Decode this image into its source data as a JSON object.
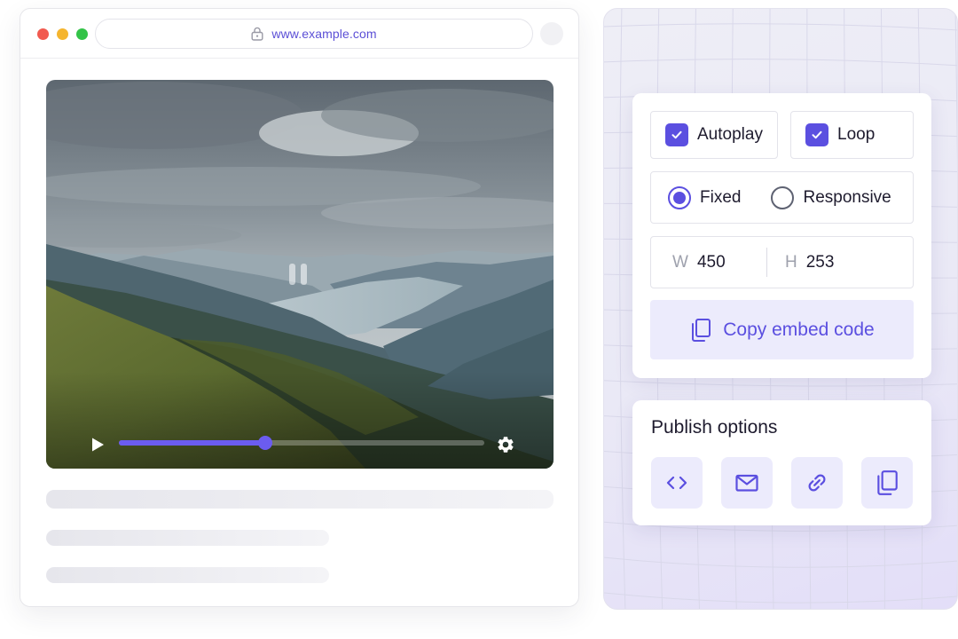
{
  "browser": {
    "url": "www.example.com",
    "icons": {
      "lock": "lock-icon"
    }
  },
  "player": {
    "progress_fraction": 0.4,
    "state": "paused",
    "icons": {
      "play": "play-icon",
      "pause": "pause-icon",
      "settings": "gear-icon"
    },
    "accent_color": "#6b5cf0"
  },
  "embed": {
    "autoplay": {
      "label": "Autoplay",
      "checked": true
    },
    "loop": {
      "label": "Loop",
      "checked": true
    },
    "size_mode": {
      "options": [
        {
          "label": "Fixed",
          "selected": true
        },
        {
          "label": "Responsive",
          "selected": false
        }
      ]
    },
    "width": {
      "prefix": "W",
      "value": "450"
    },
    "height": {
      "prefix": "H",
      "value": "253"
    },
    "copy_button": {
      "label": "Copy embed code",
      "icon": "copy-icon"
    }
  },
  "publish": {
    "title": "Publish options",
    "buttons": [
      {
        "icon": "code-icon"
      },
      {
        "icon": "email-icon"
      },
      {
        "icon": "link-icon"
      },
      {
        "icon": "copy-icon"
      }
    ]
  },
  "colors": {
    "accent": "#5b4fe0",
    "accent_soft": "#ecebfc",
    "traffic_red": "#f15a4f",
    "traffic_yellow": "#f5b52e",
    "traffic_green": "#33c348"
  }
}
